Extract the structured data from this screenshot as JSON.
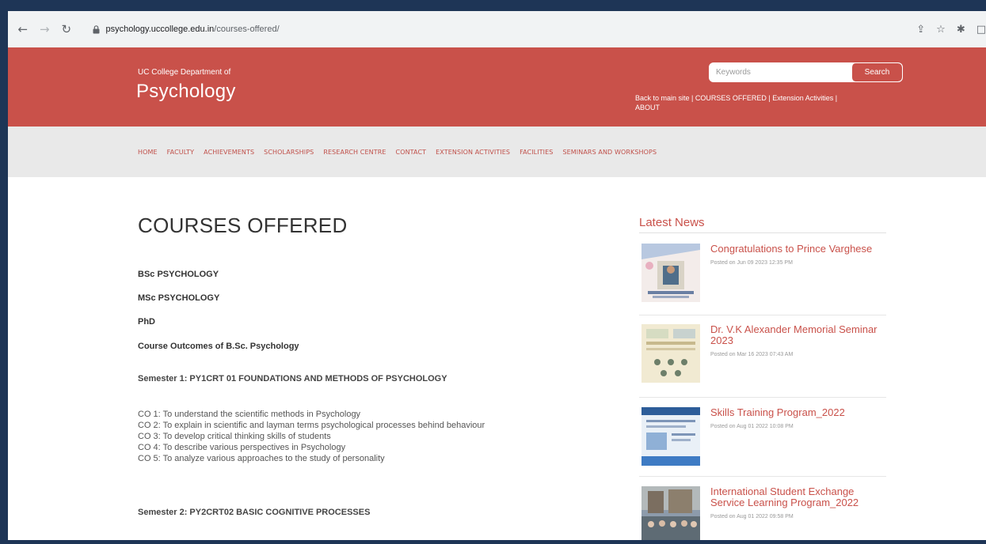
{
  "browser": {
    "url_domain": "psychology.uccollege.edu.in",
    "url_path": "/courses-offered/",
    "icons": [
      "back-arrow-icon",
      "forward-arrow-icon",
      "reload-icon",
      "lock-icon",
      "share-icon",
      "star-icon",
      "puzzle-icon",
      "window-icon"
    ]
  },
  "header": {
    "dept_small": "UC College Department of",
    "dept_name": "Psychology",
    "search_placeholder": "Keywords",
    "search_button": "Search",
    "top_links": {
      "back": "Back to main site",
      "sep1": " | ",
      "courses": "COURSES OFFERED",
      "sep2": " | ",
      "extension": "Extension Activities",
      "sep3": " | ",
      "about": "ABOUT"
    },
    "colors": {
      "header": "#c9514a",
      "nav_bg": "#e9e9e9",
      "accent": "#c9514a"
    }
  },
  "nav": {
    "items": [
      "HOME",
      "FACULTY",
      "ACHIEVEMENTS",
      "SCHOLARSHIPS",
      "RESEARCH CENTRE",
      "CONTACT",
      "EXTENSION ACTIVITIES",
      "FACILITIES",
      "SEMINARS AND WORKSHOPS"
    ]
  },
  "content": {
    "title": "COURSES OFFERED",
    "courses": [
      "BSc PSYCHOLOGY",
      "MSc PSYCHOLOGY",
      "PhD",
      "Course Outcomes of B.Sc. Psychology"
    ],
    "sem1_title": "Semester 1: PY1CRT 01 FOUNDATIONS AND METHODS OF PSYCHOLOGY",
    "sem1_cos": [
      "CO 1: To understand the scientific methods in Psychology",
      "CO 2: To explain in scientific and layman terms psychological processes behind behaviour",
      "CO 3: To develop critical thinking skills of students",
      "CO 4: To describe various perspectives in Psychology",
      "CO 5: To analyze various approaches to the study of personality"
    ],
    "sem2_title": "Semester 2: PY2CRT02 BASIC COGNITIVE PROCESSES"
  },
  "sidebar": {
    "heading": "Latest News",
    "news": [
      {
        "title": "Congratulations to Prince Varghese",
        "meta": "Posted on Jun 09 2023 12:35 PM"
      },
      {
        "title": "Dr. V.K Alexander Memorial Seminar 2023",
        "meta": "Posted on Mar 16 2023 07:43 AM"
      },
      {
        "title": "Skills Training Program_2022",
        "meta": "Posted on Aug 01 2022 10:08 PM"
      },
      {
        "title": "International Student Exchange Service Learning Program_2022",
        "meta": "Posted on Aug 01 2022 09:58 PM"
      }
    ]
  }
}
